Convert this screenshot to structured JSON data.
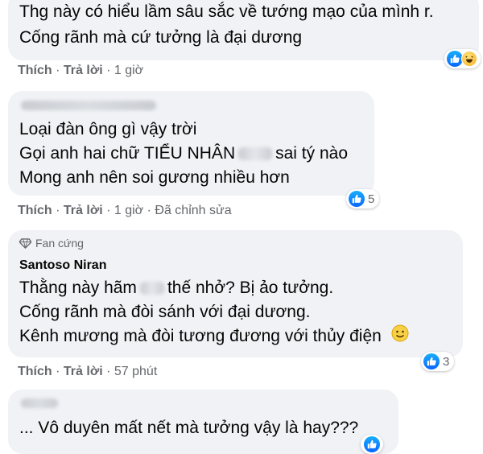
{
  "comments": [
    {
      "lines": [
        "Thg này có hiểu lầm sâu sắc về tướng mạo của mình r.",
        "Cống rãnh mà cứ tưởng là đại dương"
      ],
      "actions": {
        "like": "Thích",
        "reply": "Trả lời",
        "sep": "·",
        "time": "1 giờ"
      },
      "reactions": {
        "icons": [
          "like-icon",
          "haha-icon"
        ],
        "count": ""
      }
    },
    {
      "author_redacted": true,
      "lines": [
        "Loại đàn ông gì vậy trời",
        "Gọi anh hai chữ TIỂU NHÂN",
        "sai tý nào",
        "Mong anh nên soi gương nhiều hơn"
      ],
      "actions": {
        "like": "Thích",
        "reply": "Trả lời",
        "sep": "·",
        "time": "1 giờ",
        "edited": "Đã chỉnh sửa"
      },
      "reactions": {
        "icons": [
          "like-icon"
        ],
        "count": "5"
      }
    },
    {
      "badge": "Fan cứng",
      "author": "Santoso Niran",
      "lines": [
        "Thằng này hãm",
        "thế nhở? Bị ảo tưởng.",
        "Cống rãnh mà đòi sánh với đại dương.",
        "Kênh mương mà đòi tương đương với thủy điện"
      ],
      "actions": {
        "like": "Thích",
        "reply": "Trả lời",
        "sep": "·",
        "time": "57 phút"
      },
      "reactions": {
        "icons": [
          "like-icon"
        ],
        "count": "3"
      }
    },
    {
      "author_redacted": true,
      "lines": [
        "... Vô duyên mất nết mà tưởng vậy là hay???"
      ]
    }
  ],
  "colors": {
    "bubble": "#f0f2f5",
    "meta": "#65676b",
    "like_blue": "#0866ff",
    "text": "#050505"
  }
}
